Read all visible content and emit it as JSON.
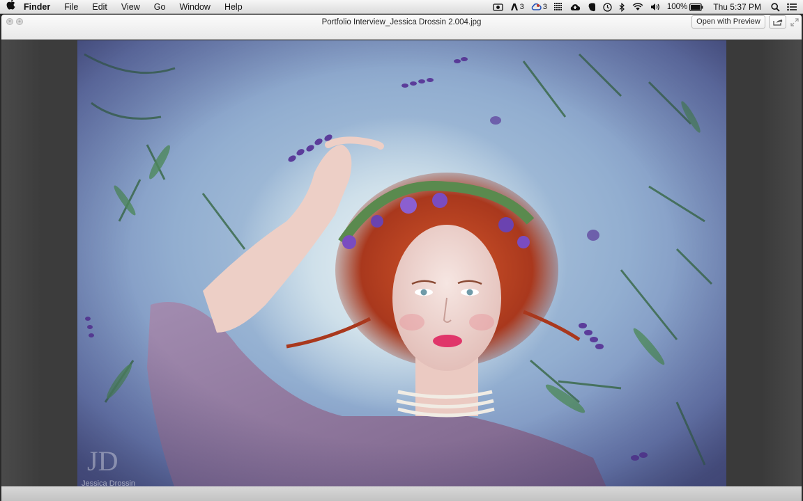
{
  "menubar": {
    "app_name": "Finder",
    "menus": [
      "File",
      "Edit",
      "View",
      "Go",
      "Window",
      "Help"
    ],
    "status": {
      "adobe_count": "3",
      "cc_count": "3",
      "battery": "100%",
      "clock": "Thu 5:37 PM"
    }
  },
  "window": {
    "title": "Portfolio Interview_Jessica Drossin 2.004.jpg",
    "open_with_label": "Open with Preview"
  },
  "photo": {
    "watermark_monogram": "JD",
    "watermark_name": "Jessica Drossin"
  },
  "colors": {
    "hair": "#b5401f",
    "lavender": "#5b3c9a",
    "dress": "#8e7399",
    "milk": "#dfeaf0",
    "leaf": "#3c6b4c"
  }
}
